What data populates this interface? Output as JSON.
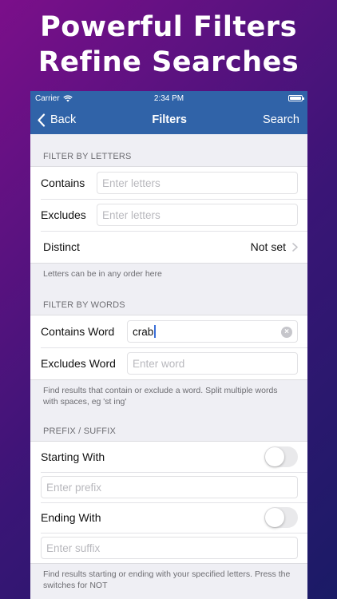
{
  "headline": {
    "line1": "Powerful Filters",
    "line2": "Refine Searches"
  },
  "status": {
    "carrier": "Carrier",
    "time": "2:34 PM"
  },
  "nav": {
    "back": "Back",
    "title": "Filters",
    "search": "Search"
  },
  "letters": {
    "header": "FILTER BY LETTERS",
    "contains_label": "Contains",
    "contains_placeholder": "Enter letters",
    "excludes_label": "Excludes",
    "excludes_placeholder": "Enter letters",
    "distinct_label": "Distinct",
    "distinct_value": "Not set",
    "note": "Letters can be in any order here"
  },
  "words": {
    "header": "FILTER BY WORDS",
    "contains_label": "Contains Word",
    "contains_value": "crab",
    "excludes_label": "Excludes Word",
    "excludes_placeholder": "Enter word",
    "note": "Find results that contain or exclude a word. Split multiple words with spaces, eg 'st ing'"
  },
  "affix": {
    "header": "PREFIX / SUFFIX",
    "starting_label": "Starting With",
    "prefix_placeholder": "Enter prefix",
    "ending_label": "Ending With",
    "suffix_placeholder": "Enter suffix",
    "note": "Find results starting or ending with your specified letters. Press the switches for NOT"
  },
  "colors": {
    "accent": "#3063a8",
    "caret": "#3b6fd8"
  }
}
